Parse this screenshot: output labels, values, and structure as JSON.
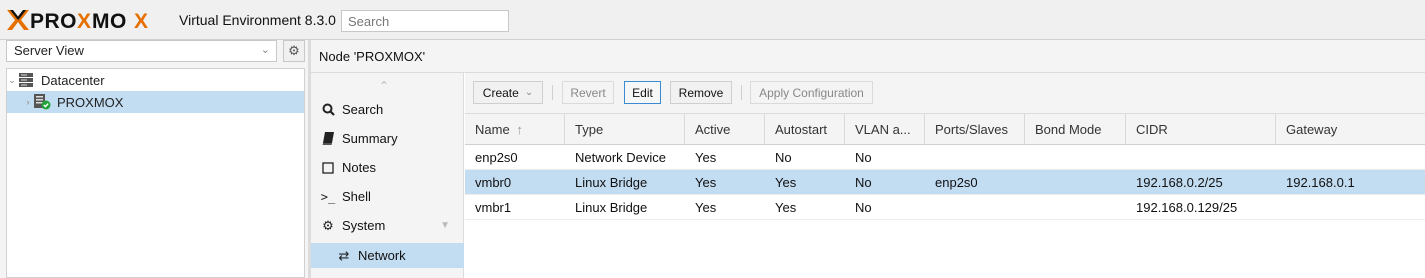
{
  "header": {
    "logo_text": "PROXMOX",
    "version": "Virtual Environment 8.3.0",
    "search_placeholder": "Search"
  },
  "sidebar": {
    "view_select": "Server View",
    "tree": [
      {
        "label": "Datacenter",
        "icon": "datacenter-icon"
      },
      {
        "label": "PROXMOX",
        "icon": "node-online-icon",
        "selected": true
      }
    ]
  },
  "panel": {
    "title": "Node 'PROXMOX'",
    "menu": [
      {
        "label": "Search",
        "icon": "search-icon"
      },
      {
        "label": "Summary",
        "icon": "book-icon"
      },
      {
        "label": "Notes",
        "icon": "notes-icon"
      },
      {
        "label": "Shell",
        "icon": "terminal-icon"
      },
      {
        "label": "System",
        "icon": "cogs-icon",
        "expanded": true
      },
      {
        "label": "Network",
        "icon": "exchange-icon",
        "active": true
      }
    ]
  },
  "toolbar": {
    "create": "Create",
    "revert": "Revert",
    "edit": "Edit",
    "remove": "Remove",
    "apply": "Apply Configuration"
  },
  "grid": {
    "columns": [
      "Name",
      "Type",
      "Active",
      "Autostart",
      "VLAN a...",
      "Ports/Slaves",
      "Bond Mode",
      "CIDR",
      "Gateway"
    ],
    "sort_indicator": "↑",
    "rows": [
      [
        "enp2s0",
        "Network Device",
        "Yes",
        "No",
        "No",
        "",
        "",
        "",
        ""
      ],
      [
        "vmbr0",
        "Linux Bridge",
        "Yes",
        "Yes",
        "No",
        "enp2s0",
        "",
        "192.168.0.2/25",
        "192.168.0.1"
      ],
      [
        "vmbr1",
        "Linux Bridge",
        "Yes",
        "Yes",
        "No",
        "",
        "",
        "192.168.0.129/25",
        ""
      ]
    ],
    "selected_row": 1
  },
  "colors": {
    "brand_orange": "#e57000",
    "selection": "#c2dcf2",
    "focus_border": "#3b8bd3"
  }
}
